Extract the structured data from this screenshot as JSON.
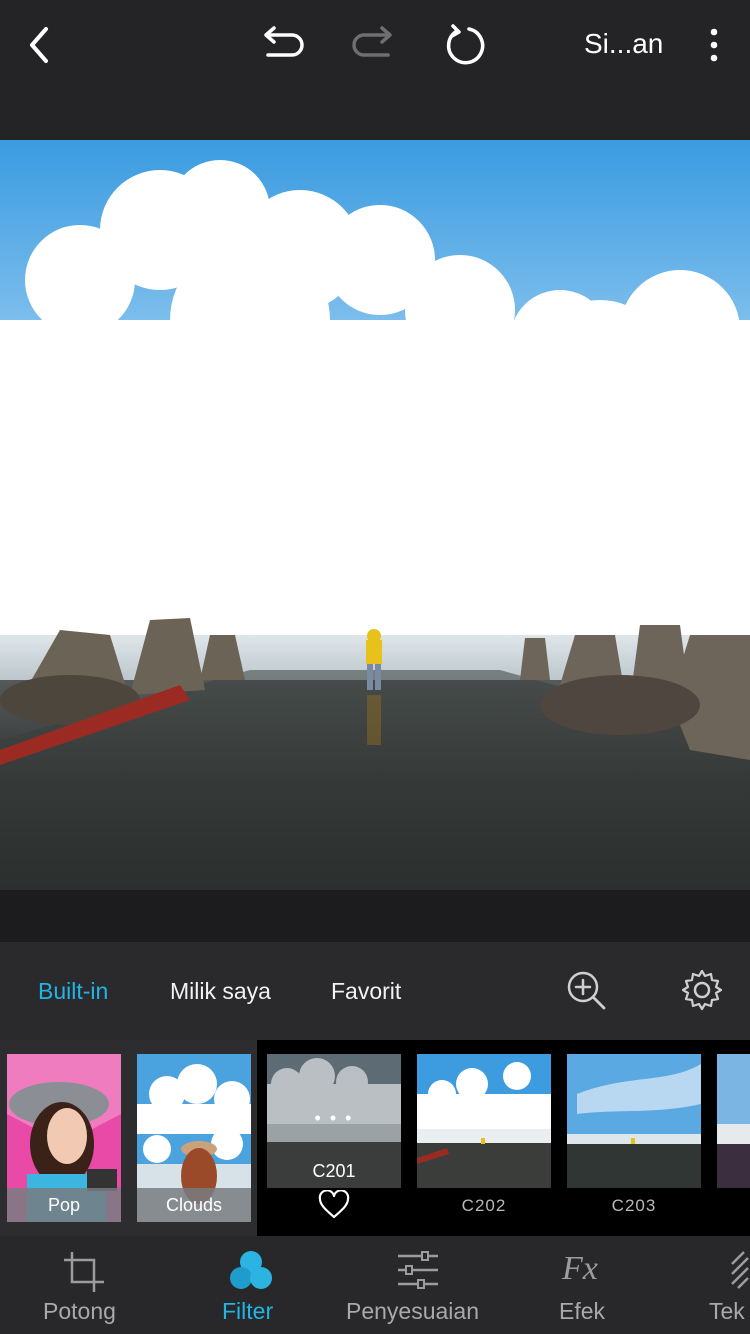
{
  "toolbar": {
    "save_label": "Si...an",
    "icons": [
      "back-icon",
      "undo-icon",
      "redo-icon",
      "reset-icon",
      "more-icon"
    ]
  },
  "filter_tabs": [
    {
      "label": "Built-in",
      "active": true
    },
    {
      "label": "Milik saya",
      "active": false
    },
    {
      "label": "Favorit",
      "active": false
    }
  ],
  "filter_tools": [
    "zoom-in-icon",
    "gear-icon"
  ],
  "filters": [
    {
      "label": "Pop"
    },
    {
      "label": "Clouds"
    },
    {
      "label": "C201",
      "selected": true,
      "more": "• • •"
    },
    {
      "label": "C202"
    },
    {
      "label": "C203"
    }
  ],
  "bottom_nav": [
    {
      "label": "Potong",
      "icon": "crop-icon",
      "active": false
    },
    {
      "label": "Filter",
      "icon": "filter-icon",
      "active": true
    },
    {
      "label": "Penyesuaian",
      "icon": "sliders-icon",
      "active": false
    },
    {
      "label": "Efek",
      "icon": "fx-icon",
      "active": false
    },
    {
      "label": "Tek",
      "icon": "text-icon",
      "active": false
    }
  ],
  "colors": {
    "accent": "#21b4e6",
    "background": "#1c1c1e"
  }
}
